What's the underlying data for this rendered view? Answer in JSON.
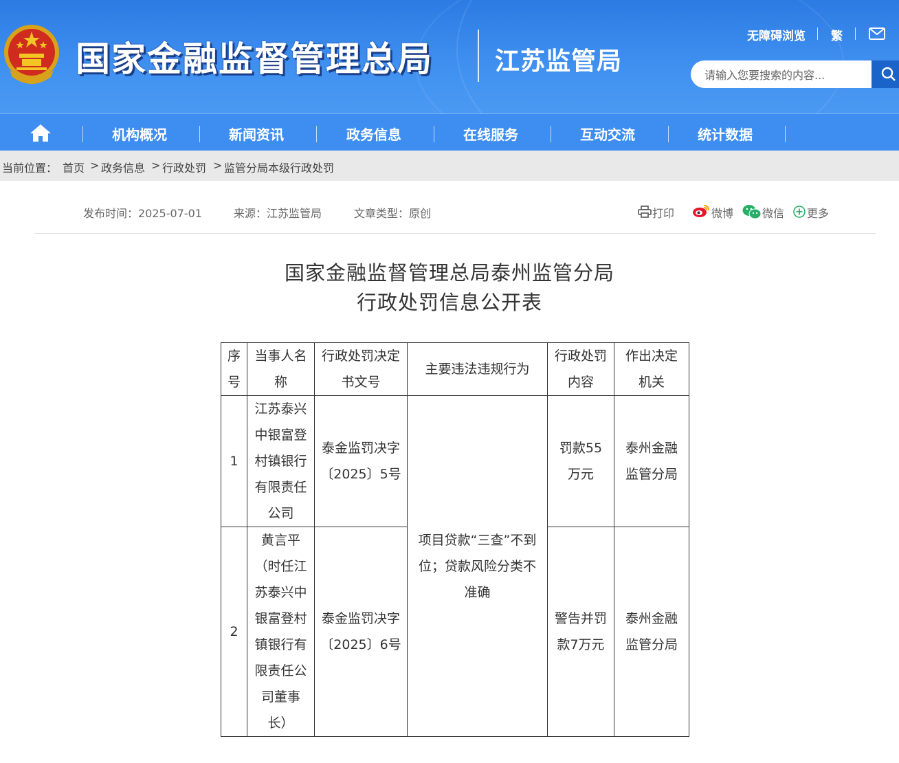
{
  "header": {
    "site_title": "国家金融监督管理总局",
    "sub_title": "江苏监管局",
    "accessibility_label": "无障碍浏览",
    "traditional_label": "繁",
    "search_placeholder": "请输入您要搜索的内容..."
  },
  "nav": {
    "items": [
      {
        "label": "机构概况"
      },
      {
        "label": "新闻资讯"
      },
      {
        "label": "政务信息"
      },
      {
        "label": "在线服务"
      },
      {
        "label": "互动交流"
      },
      {
        "label": "统计数据"
      }
    ]
  },
  "breadcrumb": {
    "prefix": "当前位置：",
    "items": [
      "首页",
      "政务信息",
      "行政处罚",
      "监管分局本级行政处罚"
    ],
    "separator": ">"
  },
  "meta": {
    "publish_time": "发布时间：2025-07-01",
    "source": "来源：江苏监管局",
    "article_type": "文章类型：原创"
  },
  "share": {
    "print": "打印",
    "weibo": "微博",
    "wechat": "微信",
    "more": "更多"
  },
  "document": {
    "title_line1": "国家金融监督管理总局泰州监管分局",
    "title_line2": "行政处罚信息公开表"
  },
  "table": {
    "headers": [
      "序号",
      "当事人名称",
      "行政处罚决定书文号",
      "主要违法违规行为",
      "行政处罚内容",
      "作出决定机关"
    ],
    "shared_violation": "项目贷款“三查”不到位；贷款风险分类不准确",
    "rows": [
      {
        "no": "1",
        "party": "江苏泰兴中银富登村镇银行有限责任公司",
        "doc_no": "泰金监罚决字〔2025〕5号",
        "penalty": "罚款55万元",
        "authority": "泰州金融监管分局"
      },
      {
        "no": "2",
        "party": "黄言平（时任江苏泰兴中银富登村镇银行有限责任公司董事长）",
        "doc_no": "泰金监罚决字〔2025〕6号",
        "penalty": "警告并罚款7万元",
        "authority": "泰州金融监管分局"
      }
    ]
  }
}
